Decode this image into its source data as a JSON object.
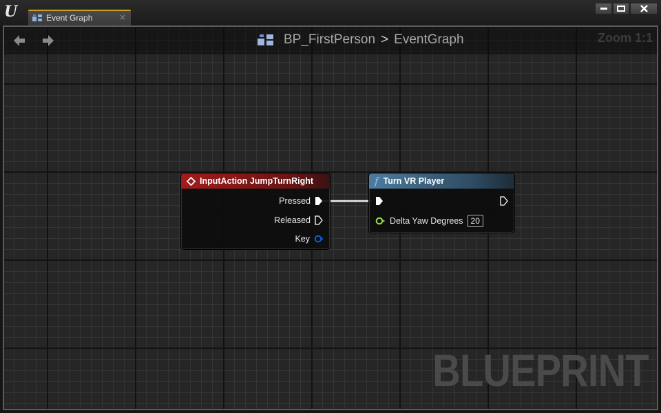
{
  "window": {
    "logo": "U",
    "tab": {
      "label": "Event Graph",
      "close_glyph": "×",
      "icon": "graph-icon"
    },
    "controls": {
      "minimize": "minimize-icon",
      "maximize": "maximize-icon",
      "close": "close-icon"
    }
  },
  "toolbar": {
    "back_icon": "arrow-left-icon",
    "forward_icon": "arrow-right-icon",
    "breadcrumb": {
      "root": "BP_FirstPerson",
      "separator": ">",
      "current": "EventGraph"
    },
    "zoom_label": "Zoom 1:1"
  },
  "graph": {
    "watermark": "BLUEPRINT",
    "nodes": [
      {
        "title": "InputAction JumpTurnRight",
        "header_color": "#a31b1b",
        "pins": [
          {
            "label": "Pressed",
            "type": "exec",
            "connected": true
          },
          {
            "label": "Released",
            "type": "exec",
            "connected": false
          },
          {
            "label": "Key",
            "type": "struct",
            "color": "#0a5fd6"
          }
        ]
      },
      {
        "title": "Turn VR Player",
        "header_color": "#4d7b9e",
        "icon": "function-icon",
        "icon_glyph": "f",
        "pins": [
          {
            "label": "",
            "type": "exec-in",
            "connected": true
          },
          {
            "label": "",
            "type": "exec-out",
            "connected": false
          },
          {
            "label": "Delta Yaw Degrees",
            "type": "float",
            "color": "#9ae34a",
            "value": "20"
          }
        ]
      }
    ],
    "connections": [
      {
        "from": "InputAction JumpTurnRight.Pressed",
        "to": "Turn VR Player.exec-in"
      }
    ]
  }
}
